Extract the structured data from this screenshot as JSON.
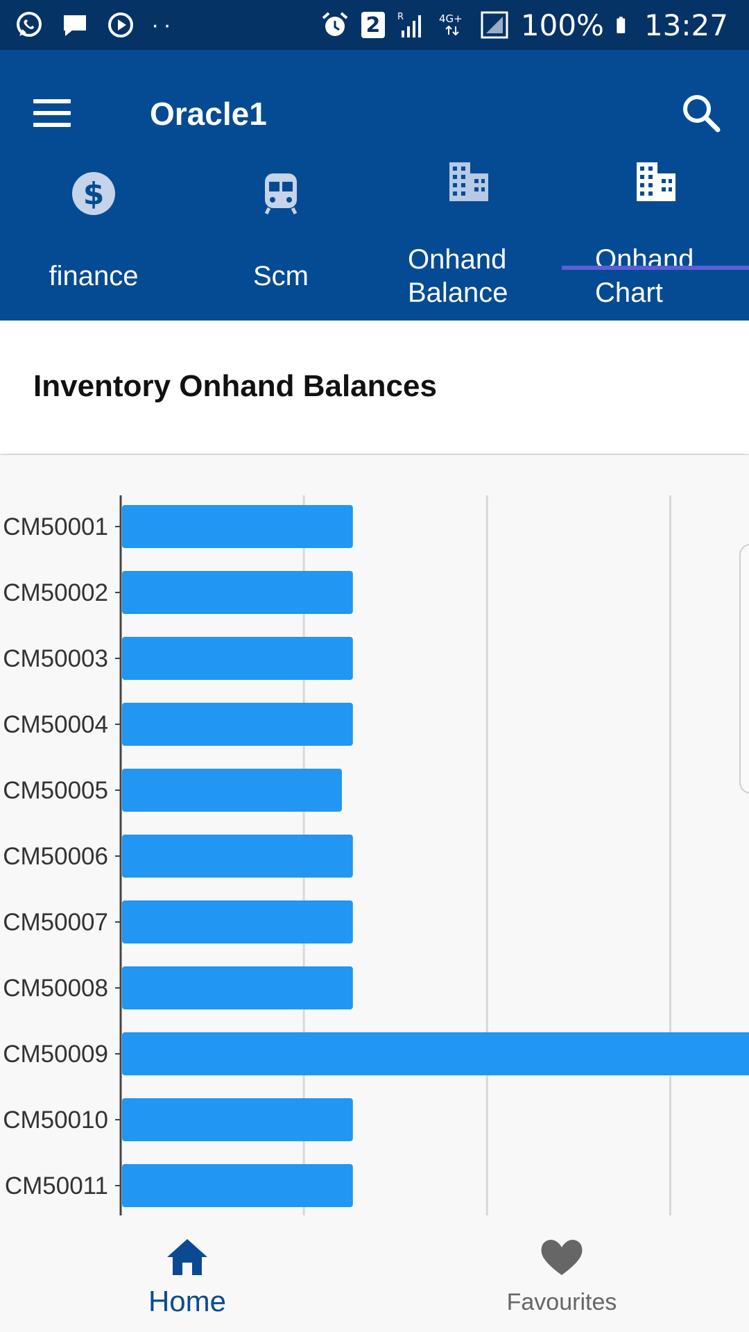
{
  "status_bar": {
    "left_icons": [
      "whatsapp-icon",
      "message-icon",
      "play-icon",
      "more-dots-icon"
    ],
    "notification_count": "2",
    "battery": "100%",
    "time": "13:27",
    "right_icons": [
      "alarm-icon",
      "signal-icon",
      "4g-icon",
      "battery-icon"
    ]
  },
  "app_bar": {
    "title": "Oracle1",
    "menu_icon": "hamburger-menu-icon",
    "search_icon": "search-icon"
  },
  "tabs": [
    {
      "label": "finance",
      "icon": "dollar-icon",
      "selected": false
    },
    {
      "label": "Scm",
      "icon": "train-icon",
      "selected": false
    },
    {
      "label_line1": "Onhand",
      "label_line2": "Balance",
      "icon": "building-icon",
      "selected": false
    },
    {
      "label_line1": "Onhand",
      "label_line2": "Chart",
      "icon": "building-icon",
      "selected": true
    }
  ],
  "page": {
    "heading": "Inventory Onhand Balances"
  },
  "colors": {
    "status_bar": "#063366",
    "app_bar": "#054b94",
    "bar": "#2196f3",
    "tab_indicator": "#5a5fd6",
    "home_active": "#0b4a92",
    "inactive": "#666666"
  },
  "chart_data": {
    "type": "bar",
    "orientation": "horizontal",
    "categories": [
      "CM50001",
      "CM50002",
      "CM50003",
      "CM50004",
      "CM50005",
      "CM50006",
      "CM50007",
      "CM50008",
      "CM50009",
      "CM50010",
      "CM50011"
    ],
    "values": [
      1.26,
      1.26,
      1.26,
      1.26,
      1.2,
      1.26,
      1.26,
      1.26,
      3.5,
      1.26,
      1.26
    ],
    "xlim": [
      0,
      3.43
    ],
    "gridlines_at": [
      1,
      2,
      3
    ],
    "grid": true,
    "title": "",
    "xlabel": "",
    "ylabel": ""
  },
  "bottom_nav": {
    "items": [
      {
        "label": "Home",
        "icon": "home-icon",
        "active": true
      },
      {
        "label": "Favourites",
        "icon": "heart-icon",
        "active": false
      }
    ]
  }
}
